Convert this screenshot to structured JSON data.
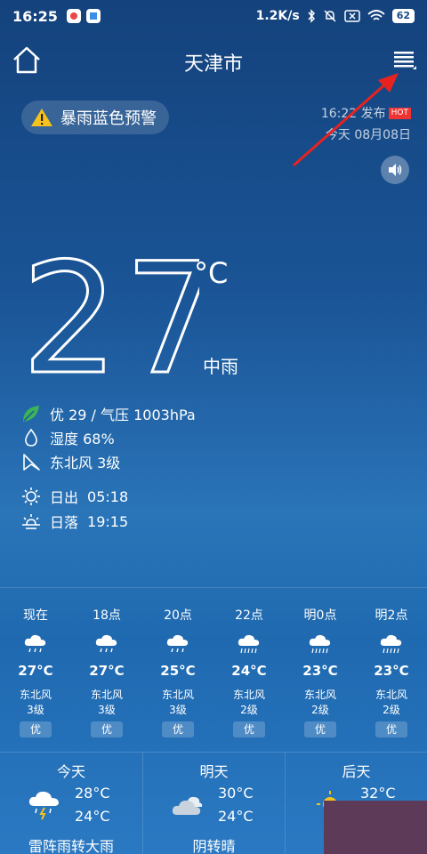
{
  "statusbar": {
    "time": "16:25",
    "net_speed": "1.2K/s",
    "battery": "62"
  },
  "header": {
    "city": "天津市"
  },
  "alert": {
    "text": "暴雨蓝色预警"
  },
  "publish": {
    "time_text": "16:22 发布",
    "hot": "HOT",
    "date_text": "今天 08月08日"
  },
  "current": {
    "temp": "27",
    "unit": "°C",
    "condition": "中雨",
    "aqi_pressure": "优 29 / 气压 1003hPa",
    "humidity": "湿度 68%",
    "wind": "东北风 3级",
    "sunrise_label": "日出",
    "sunrise_time": "05:18",
    "sunset_label": "日落",
    "sunset_time": "19:15"
  },
  "hourly": [
    {
      "label": "现在",
      "icon": "light-rain-icon",
      "temp": "27°C",
      "wind_dir": "东北风",
      "wind_lv": "3级",
      "aqi": "优"
    },
    {
      "label": "18点",
      "icon": "light-rain-icon",
      "temp": "27°C",
      "wind_dir": "东北风",
      "wind_lv": "3级",
      "aqi": "优"
    },
    {
      "label": "20点",
      "icon": "light-rain-icon",
      "temp": "25°C",
      "wind_dir": "东北风",
      "wind_lv": "3级",
      "aqi": "优"
    },
    {
      "label": "22点",
      "icon": "moderate-rain-icon",
      "temp": "24°C",
      "wind_dir": "东北风",
      "wind_lv": "2级",
      "aqi": "优"
    },
    {
      "label": "明0点",
      "icon": "moderate-rain-icon",
      "temp": "23°C",
      "wind_dir": "东北风",
      "wind_lv": "2级",
      "aqi": "优"
    },
    {
      "label": "明2点",
      "icon": "moderate-rain-icon",
      "temp": "23°C",
      "wind_dir": "东北风",
      "wind_lv": "2级",
      "aqi": "优"
    }
  ],
  "daily": [
    {
      "label": "今天",
      "hi": "28°C",
      "lo": "24°C",
      "text": "雷阵雨转大雨",
      "icon": "thunderstorm-icon"
    },
    {
      "label": "明天",
      "hi": "30°C",
      "lo": "24°C",
      "text": "阴转晴",
      "icon": "cloudy-icon"
    },
    {
      "label": "后天",
      "hi": "32°C",
      "lo": "",
      "text": "",
      "icon": "sunny-icon"
    }
  ]
}
